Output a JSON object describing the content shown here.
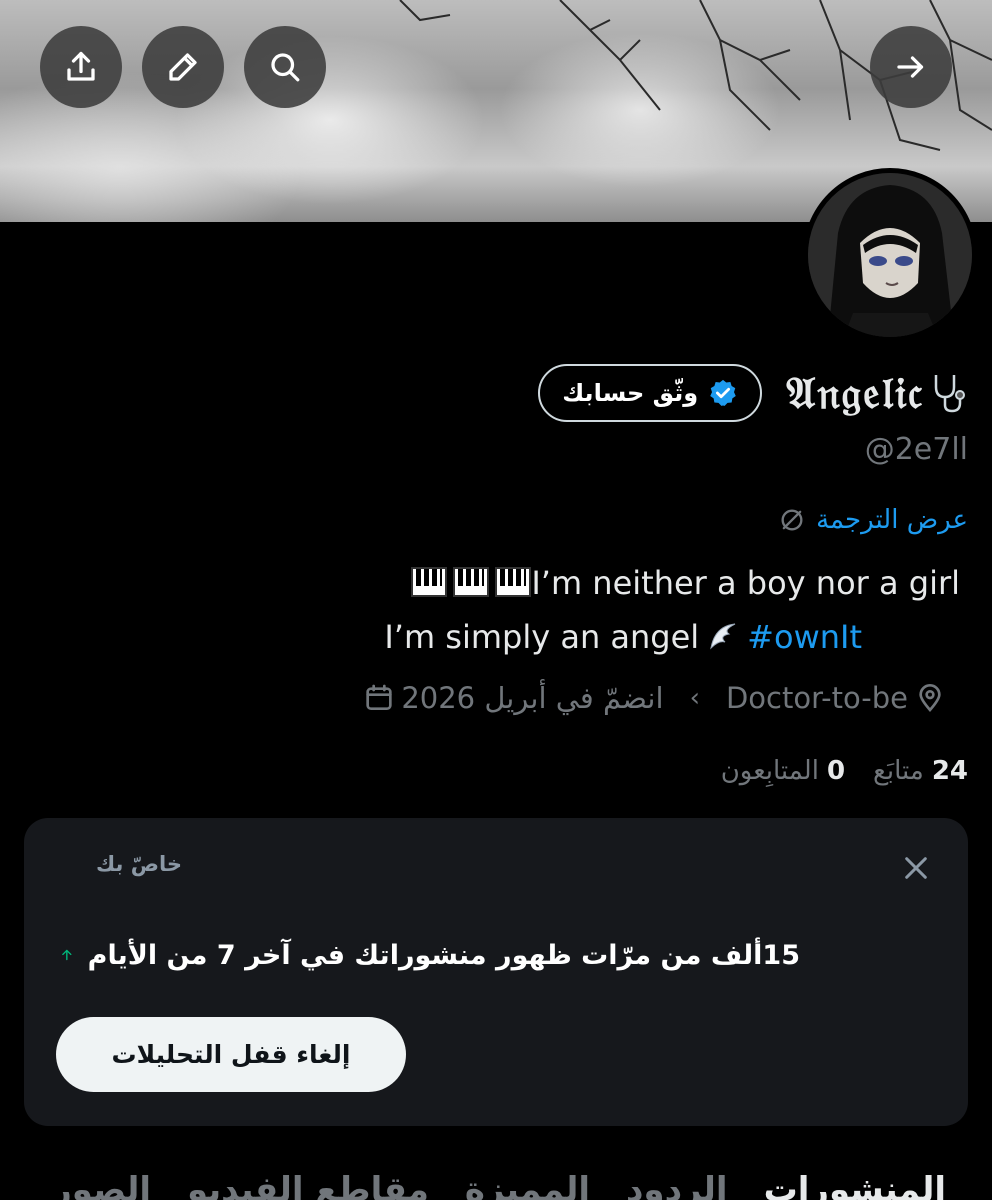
{
  "profile": {
    "display_name": "𝔄𝔫𝔤𝔢𝔩𝔦𝔠",
    "handle": "@2e7ll",
    "verify_label": "وثّق حسابك",
    "translate_label": "عرض الترجمة",
    "bio": {
      "line1": "I’m neither a boy nor a girl",
      "line2_text": "I’m simply an angel",
      "hashtag": "#ownIt"
    },
    "location": "Doctor-to-be",
    "joined": "انضمّ في أبريل 2026",
    "following_count": "24",
    "following_label": "متابَع",
    "followers_count": "0",
    "followers_label": "المتابِعون"
  },
  "analytics_card": {
    "label": "خاصّ بك",
    "title": "15ألف من مرّات ظهور منشوراتك في آخر 7 من الأيام",
    "button": "إلغاء قفل التحليلات"
  },
  "tabs": [
    "المنشورات",
    "الردود",
    "المميزة",
    "مقاطع الفيديو",
    "الصور"
  ],
  "icons": {
    "back": "arrow-right-icon",
    "search": "search-icon",
    "edit": "pencil-icon",
    "share": "share-icon",
    "verified": "verified-badge-icon",
    "translate": "translate-icon",
    "location": "location-pin-icon",
    "calendar": "calendar-icon",
    "close": "close-icon",
    "trend": "arrow-up-icon"
  },
  "colors": {
    "accent": "#1d9bf0",
    "trend_up": "#00ba7c",
    "muted": "#71767b"
  }
}
